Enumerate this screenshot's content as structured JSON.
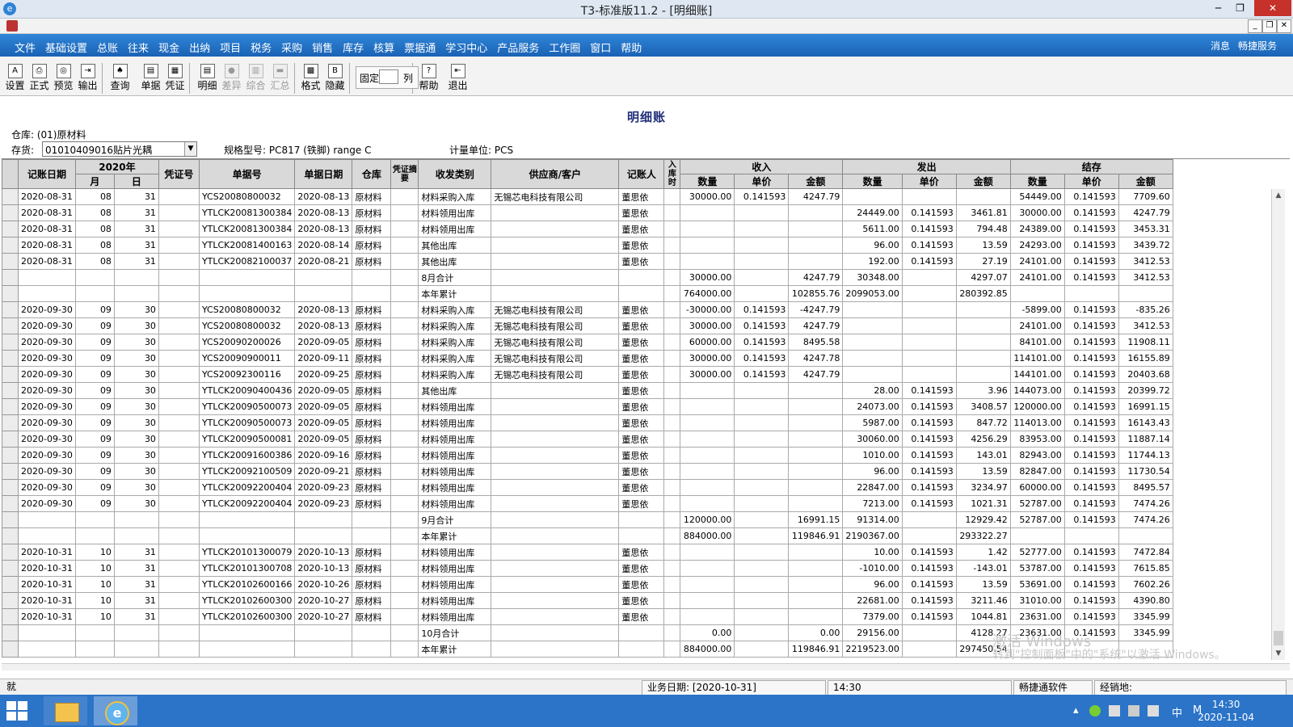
{
  "window": {
    "title": "T3-标准版11.2 - [明细账]"
  },
  "menu": [
    "文件",
    "基础设置",
    "总账",
    "往来",
    "现金",
    "出纳",
    "项目",
    "税务",
    "采购",
    "销售",
    "库存",
    "核算",
    "票据通",
    "学习中心",
    "产品服务",
    "工作圈",
    "窗口",
    "帮助"
  ],
  "menu_right": {
    "messages": "消息",
    "service": "畅捷服务"
  },
  "toolbar": {
    "buttons": [
      {
        "label": "设置",
        "enabled": true
      },
      {
        "label": "正式",
        "enabled": true
      },
      {
        "label": "预览",
        "enabled": true
      },
      {
        "label": "输出",
        "enabled": true
      },
      {
        "label": "查询",
        "enabled": true
      },
      {
        "label": "单据",
        "enabled": true
      },
      {
        "label": "凭证",
        "enabled": true
      },
      {
        "label": "明细",
        "enabled": true
      },
      {
        "label": "差异",
        "enabled": false
      },
      {
        "label": "综合",
        "enabled": false
      },
      {
        "label": "汇总",
        "enabled": false
      },
      {
        "label": "格式",
        "enabled": true
      },
      {
        "label": "隐藏",
        "enabled": true
      },
      {
        "label": "帮助",
        "enabled": true
      },
      {
        "label": "退出",
        "enabled": true
      }
    ],
    "fix_label": "固定",
    "fix_value": "",
    "col_label": "列"
  },
  "report": {
    "title": "明细账",
    "warehouse": "仓库: (01)原材料",
    "inventory_label": "存货:",
    "inventory_value": "01010409016贴片光耦",
    "spec": "规格型号: PC817 (铁脚) range C",
    "unit": "计量单位: PCS"
  },
  "headers": {
    "date": "记账日期",
    "year": "2020年",
    "month": "月",
    "day": "日",
    "voucher": "凭证号",
    "doc_no": "单据号",
    "doc_date": "单据日期",
    "warehouse": "仓库",
    "voucher_summary": "凭证摘要",
    "io_type": "收发类别",
    "supplier": "供应商/客户",
    "bookkeeper": "记账人",
    "in_out": "入库时",
    "income": "收入",
    "outgo": "发出",
    "balance": "结存",
    "qty": "数量",
    "price": "单价",
    "amount": "金额"
  },
  "rows": [
    [
      "2020-08-31",
      "08",
      "31",
      "",
      "YCS20080800032",
      "2020-08-13",
      "原材料",
      "",
      "材料采购入库",
      "无锡芯电科技有限公司",
      "董思依",
      "",
      "30000.00",
      "0.141593",
      "4247.79",
      "",
      "",
      "",
      "54449.00",
      "0.141593",
      "7709.60"
    ],
    [
      "2020-08-31",
      "08",
      "31",
      "",
      "YTLCK20081300384",
      "2020-08-13",
      "原材料",
      "",
      "材料领用出库",
      "",
      "董思依",
      "",
      "",
      "",
      "",
      "24449.00",
      "0.141593",
      "3461.81",
      "30000.00",
      "0.141593",
      "4247.79"
    ],
    [
      "2020-08-31",
      "08",
      "31",
      "",
      "YTLCK20081300384",
      "2020-08-13",
      "原材料",
      "",
      "材料领用出库",
      "",
      "董思依",
      "",
      "",
      "",
      "",
      "5611.00",
      "0.141593",
      "794.48",
      "24389.00",
      "0.141593",
      "3453.31"
    ],
    [
      "2020-08-31",
      "08",
      "31",
      "",
      "YTLCK20081400163",
      "2020-08-14",
      "原材料",
      "",
      "其他出库",
      "",
      "董思依",
      "",
      "",
      "",
      "",
      "96.00",
      "0.141593",
      "13.59",
      "24293.00",
      "0.141593",
      "3439.72"
    ],
    [
      "2020-08-31",
      "08",
      "31",
      "",
      "YTLCK20082100037",
      "2020-08-21",
      "原材料",
      "",
      "其他出库",
      "",
      "董思依",
      "",
      "",
      "",
      "",
      "192.00",
      "0.141593",
      "27.19",
      "24101.00",
      "0.141593",
      "3412.53"
    ],
    [
      "",
      "",
      "",
      "",
      "",
      "",
      "",
      "",
      "8月合计",
      "",
      "",
      "",
      "30000.00",
      "",
      "4247.79",
      "30348.00",
      "",
      "4297.07",
      "24101.00",
      "0.141593",
      "3412.53"
    ],
    [
      "",
      "",
      "",
      "",
      "",
      "",
      "",
      "",
      "本年累计",
      "",
      "",
      "",
      "764000.00",
      "",
      "102855.76",
      "2099053.00",
      "",
      "280392.85",
      "",
      "",
      ""
    ],
    [
      "2020-09-30",
      "09",
      "30",
      "",
      "YCS20080800032",
      "2020-08-13",
      "原材料",
      "",
      "材料采购入库",
      "无锡芯电科技有限公司",
      "董思依",
      "",
      "-30000.00",
      "0.141593",
      "-4247.79",
      "",
      "",
      "",
      "-5899.00",
      "0.141593",
      "-835.26"
    ],
    [
      "2020-09-30",
      "09",
      "30",
      "",
      "YCS20080800032",
      "2020-08-13",
      "原材料",
      "",
      "材料采购入库",
      "无锡芯电科技有限公司",
      "董思依",
      "",
      "30000.00",
      "0.141593",
      "4247.79",
      "",
      "",
      "",
      "24101.00",
      "0.141593",
      "3412.53"
    ],
    [
      "2020-09-30",
      "09",
      "30",
      "",
      "YCS20090200026",
      "2020-09-05",
      "原材料",
      "",
      "材料采购入库",
      "无锡芯电科技有限公司",
      "董思依",
      "",
      "60000.00",
      "0.141593",
      "8495.58",
      "",
      "",
      "",
      "84101.00",
      "0.141593",
      "11908.11"
    ],
    [
      "2020-09-30",
      "09",
      "30",
      "",
      "YCS20090900011",
      "2020-09-11",
      "原材料",
      "",
      "材料采购入库",
      "无锡芯电科技有限公司",
      "董思依",
      "",
      "30000.00",
      "0.141593",
      "4247.78",
      "",
      "",
      "",
      "114101.00",
      "0.141593",
      "16155.89"
    ],
    [
      "2020-09-30",
      "09",
      "30",
      "",
      "YCS20092300116",
      "2020-09-25",
      "原材料",
      "",
      "材料采购入库",
      "无锡芯电科技有限公司",
      "董思依",
      "",
      "30000.00",
      "0.141593",
      "4247.79",
      "",
      "",
      "",
      "144101.00",
      "0.141593",
      "20403.68"
    ],
    [
      "2020-09-30",
      "09",
      "30",
      "",
      "YTLCK20090400436",
      "2020-09-05",
      "原材料",
      "",
      "其他出库",
      "",
      "董思依",
      "",
      "",
      "",
      "",
      "28.00",
      "0.141593",
      "3.96",
      "144073.00",
      "0.141593",
      "20399.72"
    ],
    [
      "2020-09-30",
      "09",
      "30",
      "",
      "YTLCK20090500073",
      "2020-09-05",
      "原材料",
      "",
      "材料领用出库",
      "",
      "董思依",
      "",
      "",
      "",
      "",
      "24073.00",
      "0.141593",
      "3408.57",
      "120000.00",
      "0.141593",
      "16991.15"
    ],
    [
      "2020-09-30",
      "09",
      "30",
      "",
      "YTLCK20090500073",
      "2020-09-05",
      "原材料",
      "",
      "材料领用出库",
      "",
      "董思依",
      "",
      "",
      "",
      "",
      "5987.00",
      "0.141593",
      "847.72",
      "114013.00",
      "0.141593",
      "16143.43"
    ],
    [
      "2020-09-30",
      "09",
      "30",
      "",
      "YTLCK20090500081",
      "2020-09-05",
      "原材料",
      "",
      "材料领用出库",
      "",
      "董思依",
      "",
      "",
      "",
      "",
      "30060.00",
      "0.141593",
      "4256.29",
      "83953.00",
      "0.141593",
      "11887.14"
    ],
    [
      "2020-09-30",
      "09",
      "30",
      "",
      "YTLCK20091600386",
      "2020-09-16",
      "原材料",
      "",
      "材料领用出库",
      "",
      "董思依",
      "",
      "",
      "",
      "",
      "1010.00",
      "0.141593",
      "143.01",
      "82943.00",
      "0.141593",
      "11744.13"
    ],
    [
      "2020-09-30",
      "09",
      "30",
      "",
      "YTLCK20092100509",
      "2020-09-21",
      "原材料",
      "",
      "材料领用出库",
      "",
      "董思依",
      "",
      "",
      "",
      "",
      "96.00",
      "0.141593",
      "13.59",
      "82847.00",
      "0.141593",
      "11730.54"
    ],
    [
      "2020-09-30",
      "09",
      "30",
      "",
      "YTLCK20092200404",
      "2020-09-23",
      "原材料",
      "",
      "材料领用出库",
      "",
      "董思依",
      "",
      "",
      "",
      "",
      "22847.00",
      "0.141593",
      "3234.97",
      "60000.00",
      "0.141593",
      "8495.57"
    ],
    [
      "2020-09-30",
      "09",
      "30",
      "",
      "YTLCK20092200404",
      "2020-09-23",
      "原材料",
      "",
      "材料领用出库",
      "",
      "董思依",
      "",
      "",
      "",
      "",
      "7213.00",
      "0.141593",
      "1021.31",
      "52787.00",
      "0.141593",
      "7474.26"
    ],
    [
      "",
      "",
      "",
      "",
      "",
      "",
      "",
      "",
      "9月合计",
      "",
      "",
      "",
      "120000.00",
      "",
      "16991.15",
      "91314.00",
      "",
      "12929.42",
      "52787.00",
      "0.141593",
      "7474.26"
    ],
    [
      "",
      "",
      "",
      "",
      "",
      "",
      "",
      "",
      "本年累计",
      "",
      "",
      "",
      "884000.00",
      "",
      "119846.91",
      "2190367.00",
      "",
      "293322.27",
      "",
      "",
      ""
    ],
    [
      "2020-10-31",
      "10",
      "31",
      "",
      "YTLCK20101300079",
      "2020-10-13",
      "原材料",
      "",
      "材料领用出库",
      "",
      "董思依",
      "",
      "",
      "",
      "",
      "10.00",
      "0.141593",
      "1.42",
      "52777.00",
      "0.141593",
      "7472.84"
    ],
    [
      "2020-10-31",
      "10",
      "31",
      "",
      "YTLCK20101300708",
      "2020-10-13",
      "原材料",
      "",
      "材料领用出库",
      "",
      "董思依",
      "",
      "",
      "",
      "",
      "-1010.00",
      "0.141593",
      "-143.01",
      "53787.00",
      "0.141593",
      "7615.85"
    ],
    [
      "2020-10-31",
      "10",
      "31",
      "",
      "YTLCK20102600166",
      "2020-10-26",
      "原材料",
      "",
      "材料领用出库",
      "",
      "董思依",
      "",
      "",
      "",
      "",
      "96.00",
      "0.141593",
      "13.59",
      "53691.00",
      "0.141593",
      "7602.26"
    ],
    [
      "2020-10-31",
      "10",
      "31",
      "",
      "YTLCK20102600300",
      "2020-10-27",
      "原材料",
      "",
      "材料领用出库",
      "",
      "董思依",
      "",
      "",
      "",
      "",
      "22681.00",
      "0.141593",
      "3211.46",
      "31010.00",
      "0.141593",
      "4390.80"
    ],
    [
      "2020-10-31",
      "10",
      "31",
      "",
      "YTLCK20102600300",
      "2020-10-27",
      "原材料",
      "",
      "材料领用出库",
      "",
      "董思依",
      "",
      "",
      "",
      "",
      "7379.00",
      "0.141593",
      "1044.81",
      "23631.00",
      "0.141593",
      "3345.99"
    ],
    [
      "",
      "",
      "",
      "",
      "",
      "",
      "",
      "",
      "10月合计",
      "",
      "",
      "",
      "0.00",
      "",
      "0.00",
      "29156.00",
      "",
      "4128.27",
      "23631.00",
      "0.141593",
      "3345.99"
    ],
    [
      "",
      "",
      "",
      "",
      "",
      "",
      "",
      "",
      "本年累计",
      "",
      "",
      "",
      "884000.00",
      "",
      "119846.91",
      "2219523.00",
      "",
      "297450.54",
      "",
      "",
      ""
    ]
  ],
  "watermark": {
    "line1": "激活 Windows",
    "line2": "转到\"控制面板\"中的\"系统\"以激活 Windows。"
  },
  "status": {
    "ready": "就",
    "business_date": "业务日期: [2020-10-31]",
    "time": "14:30",
    "vendor": "畅捷通软件",
    "dealer": "经销地:"
  },
  "taskbar": {
    "ime": "中",
    "ime_mode": "M",
    "time": "14:30",
    "date": "2020-11-04"
  },
  "icons": [
    "app-icon",
    "close-icon",
    "minimize-icon",
    "maximize-icon",
    "windows-start-icon",
    "folder-icon",
    "ie-icon",
    "chevron-up-icon",
    "chevron-down-icon"
  ]
}
